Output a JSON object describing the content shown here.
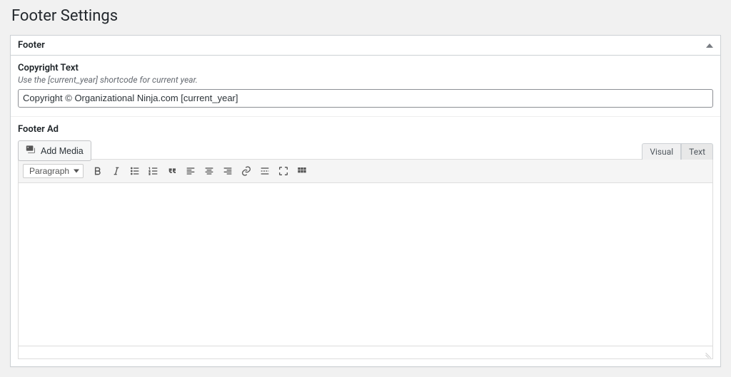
{
  "page": {
    "title": "Footer Settings"
  },
  "panel": {
    "heading": "Footer"
  },
  "copyright": {
    "label": "Copyright Text",
    "help": "Use the [current_year] shortcode for current year.",
    "value": "Copyright © Organizational Ninja.com [current_year]"
  },
  "footer_ad": {
    "label": "Footer Ad",
    "add_media": "Add Media",
    "tabs": {
      "visual": "Visual",
      "text": "Text"
    },
    "format_select": "Paragraph",
    "content": ""
  }
}
